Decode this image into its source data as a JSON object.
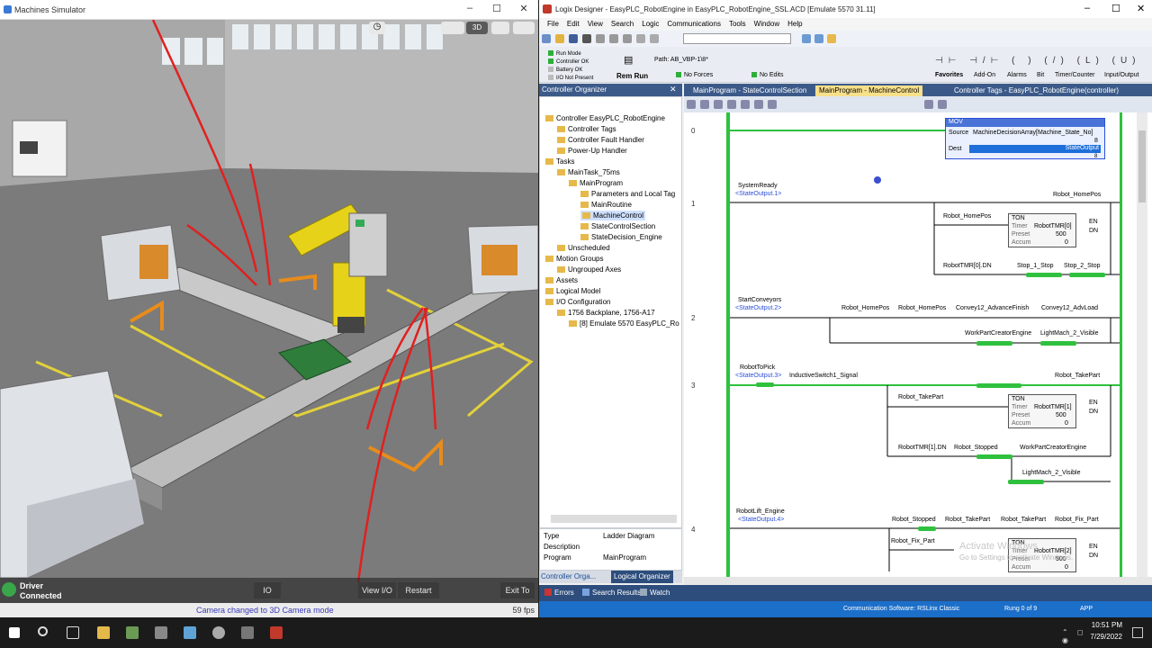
{
  "simulator": {
    "title": "Machines Simulator",
    "view_buttons": [
      "3D"
    ],
    "driver_status": "Driver",
    "driver_status2": "Connected",
    "buttons": {
      "io": "IO",
      "view_io": "View I/O",
      "restart": "Restart",
      "exit": "Exit To"
    },
    "status_message": "Camera changed to 3D Camera mode",
    "fps": "59 fps"
  },
  "logix": {
    "title": "Logix Designer - EasyPLC_RobotEngine in EasyPLC_RobotEngine_SSL.ACD [Emulate 5570 31.11]",
    "menu": [
      "File",
      "Edit",
      "View",
      "Search",
      "Logic",
      "Communications",
      "Tools",
      "Window",
      "Help"
    ],
    "controller_status": {
      "run_mode": "Run Mode",
      "controller_ok": "Controller OK",
      "battery_ok": "Battery OK",
      "io_not_present": "I/O Not Present",
      "mode": "Rem Run",
      "forces": "No Forces",
      "edits": "No Edits",
      "path": "Path: AB_VBP-1\\8*"
    },
    "element_tabs": [
      "Favorites",
      "Add-On",
      "Alarms",
      "Bit",
      "Timer/Counter",
      "Input/Output"
    ],
    "organizer": {
      "header": "Controller Organizer",
      "tree": [
        {
          "label": "Controller EasyPLC_RobotEngine",
          "depth": 0
        },
        {
          "label": "Controller Tags",
          "depth": 1
        },
        {
          "label": "Controller Fault Handler",
          "depth": 1
        },
        {
          "label": "Power-Up Handler",
          "depth": 1
        },
        {
          "label": "Tasks",
          "depth": 0
        },
        {
          "label": "MainTask_75ms",
          "depth": 1
        },
        {
          "label": "MainProgram",
          "depth": 2
        },
        {
          "label": "Parameters and Local Tag",
          "depth": 3
        },
        {
          "label": "MainRoutine",
          "depth": 3
        },
        {
          "label": "MachineControl",
          "depth": 3,
          "selected": true
        },
        {
          "label": "StateControlSection",
          "depth": 3
        },
        {
          "label": "StateDecision_Engine",
          "depth": 3
        },
        {
          "label": "Unscheduled",
          "depth": 1
        },
        {
          "label": "Motion Groups",
          "depth": 0
        },
        {
          "label": "Ungrouped Axes",
          "depth": 1
        },
        {
          "label": "Assets",
          "depth": 0
        },
        {
          "label": "Logical Model",
          "depth": 0
        },
        {
          "label": "I/O Configuration",
          "depth": 0
        },
        {
          "label": "1756 Backplane, 1756-A17",
          "depth": 1
        },
        {
          "label": "[8] Emulate 5570 EasyPLC_Ro",
          "depth": 2
        }
      ],
      "properties": [
        {
          "key": "Type",
          "value": "Ladder Diagram"
        },
        {
          "key": "Description",
          "value": ""
        },
        {
          "key": "Program",
          "value": "MainProgram"
        }
      ],
      "bottom_tabs": [
        "Controller Orga...",
        "Logical Organizer"
      ]
    },
    "editor_tabs": [
      {
        "label": "MainProgram - StateControlSection"
      },
      {
        "label": "MainProgram - MachineControl",
        "active": true
      },
      {
        "label": "Controller Tags - EasyPLC_RobotEngine(controller)"
      }
    ],
    "ladder": {
      "rung0": {
        "number": "0",
        "mov": {
          "title": "MOV",
          "source_label": "Source",
          "source": "MachineDecisionArray[Machine_State_No]",
          "source_val": "8",
          "dest_label": "Dest",
          "dest": "StateOutput",
          "dest_val": "8"
        }
      },
      "rung1": {
        "number": "1",
        "xic": "SystemReady",
        "xic_alias": "<StateOutput.1>",
        "coil": "Robot_HomePos",
        "br1_contact": "Robot_HomePos",
        "ton": {
          "title": "TON",
          "timer_label": "Timer",
          "timer": "RobotTMR[0]",
          "preset_label": "Preset",
          "preset": "500",
          "accum_label": "Accum",
          "accum": "0",
          "en": "EN",
          "dn": "DN"
        },
        "br2_contact": "RobotTMR[0].DN",
        "stop1": "Stop_1_Stop",
        "stop2": "Stop_2_Stop"
      },
      "rung2": {
        "number": "2",
        "xic": "StartConveyors",
        "xic_alias": "<StateOutput.2>",
        "c1": "Robot_HomePos",
        "c2": "Robot_HomePos",
        "coil1": "Convey12_AdvanceFinish",
        "coil2": "Convey12_AdvLoad",
        "coil3": "WorkPartCreatorEngine",
        "coil4": "LightMach_2_Visible"
      },
      "rung3": {
        "number": "3",
        "xic": "RobotToPick",
        "xic_alias": "<StateOutput.3>",
        "c2": "InductiveSwitch1_Signal",
        "coil": "Robot_TakePart",
        "br1_contact": "Robot_TakePart",
        "ton": {
          "title": "TON",
          "timer_label": "Timer",
          "timer": "RobotTMR[1]",
          "preset_label": "Preset",
          "preset": "500",
          "accum_label": "Accum",
          "accum": "0",
          "en": "EN",
          "dn": "DN"
        },
        "br2_c1": "RobotTMR[1].DN",
        "br2_c2": "Robot_Stopped",
        "coil2": "WorkPartCreatorEngine",
        "coil3": "LightMach_2_Visible"
      },
      "rung4": {
        "number": "4",
        "xic": "RobotLift_Engine",
        "xic_alias": "<StateOutput.4>",
        "c1": "Robot_Stopped",
        "c2": "Robot_TakePart",
        "c3": "Robot_TakePart",
        "coil": "Robot_Fix_Part",
        "br1_contact": "Robot_Fix_Part",
        "ton": {
          "title": "TON",
          "timer_label": "Timer",
          "timer": "RobotTMR[2]",
          "preset_label": "Preset",
          "preset": "500",
          "accum_label": "Accum",
          "accum": "0",
          "en": "EN",
          "dn": "DN"
        }
      }
    },
    "bottom_tabs": [
      "Errors",
      "Search Results",
      "Watch"
    ],
    "statusbar": {
      "comm": "Communication Software: RSLinx Classic",
      "rung": "Rung 0 of 9",
      "app": "APP"
    },
    "watermark": {
      "line1": "Activate Windows",
      "line2": "Go to Settings to activate Windows."
    }
  },
  "taskbar": {
    "time": "10:51 PM",
    "date": "7/29/2022"
  }
}
